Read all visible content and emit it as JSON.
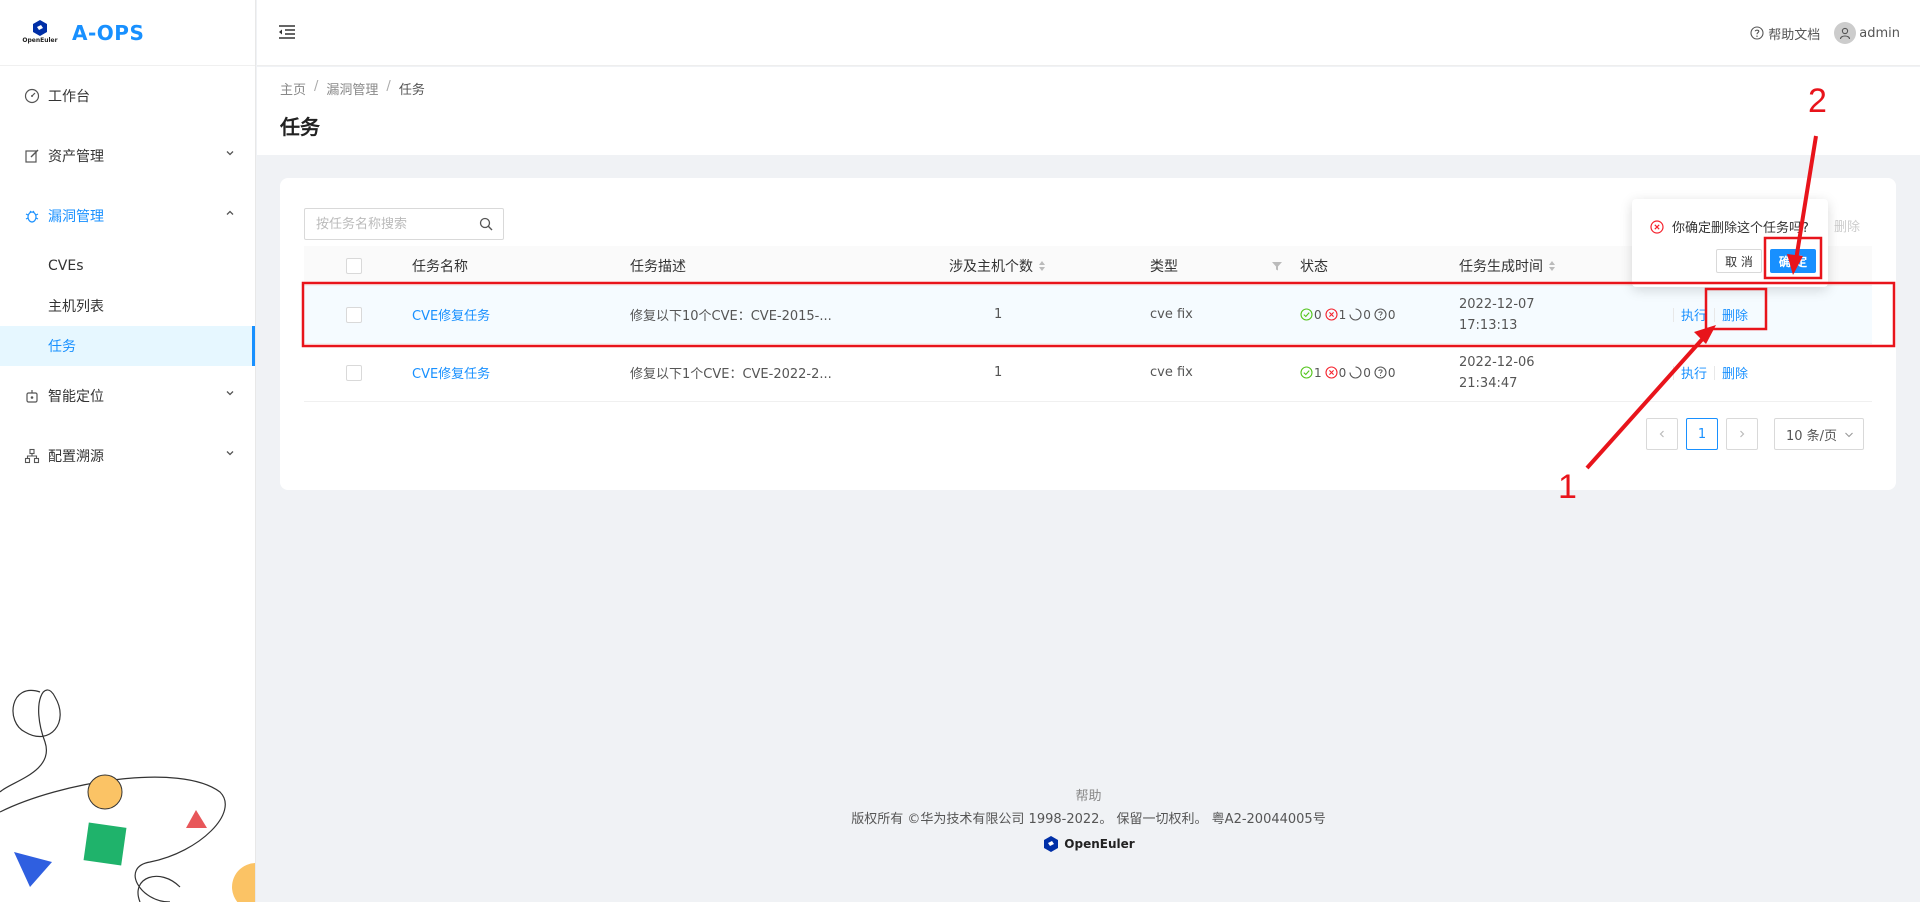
{
  "app": {
    "name": "A-OPS",
    "logo_caption": "OpenEuler"
  },
  "header": {
    "help_label": "帮助文档",
    "user_name": "admin"
  },
  "sidebar": {
    "items": [
      {
        "label": "工作台",
        "icon": "dashboard-icon"
      },
      {
        "label": "资产管理",
        "icon": "edit-icon"
      },
      {
        "label": "漏洞管理",
        "icon": "bug-icon",
        "open": true,
        "children": [
          {
            "label": "CVEs"
          },
          {
            "label": "主机列表"
          },
          {
            "label": "任务",
            "active": true
          }
        ]
      },
      {
        "label": "智能定位",
        "icon": "robot-icon"
      },
      {
        "label": "配置溯源",
        "icon": "cluster-icon"
      }
    ]
  },
  "breadcrumb": {
    "items": [
      "主页",
      "漏洞管理",
      "任务"
    ],
    "separator": "/"
  },
  "page": {
    "title": "任务"
  },
  "search": {
    "placeholder": "按任务名称搜索",
    "value": ""
  },
  "toolbar": {
    "batch_delete": "删除"
  },
  "table": {
    "columns": [
      "任务名称",
      "任务描述",
      "涉及主机个数",
      "类型",
      "状态",
      "任务生成时间"
    ],
    "rows": [
      {
        "name": "CVE修复任务",
        "desc": "修复以下10个CVE：CVE-2015-...",
        "hosts": "1",
        "type": "cve fix",
        "status": {
          "succeed": "0",
          "fail": "1",
          "running": "0",
          "unknown": "0"
        },
        "date": "2022-12-07",
        "time": "17:13:13",
        "action_run": "执行",
        "action_delete": "删除"
      },
      {
        "name": "CVE修复任务",
        "desc": "修复以下1个CVE：CVE-2022-2...",
        "hosts": "1",
        "type": "cve fix",
        "status": {
          "succeed": "1",
          "fail": "0",
          "running": "0",
          "unknown": "0"
        },
        "date": "2022-12-06",
        "time": "21:34:47",
        "action_run": "执行",
        "action_delete": "删除"
      }
    ]
  },
  "pagination": {
    "current": "1",
    "page_size": "10 条/页"
  },
  "popconfirm": {
    "message": "你确定删除这个任务吗?",
    "cancel": "取 消",
    "ok": "确 定"
  },
  "annotations": {
    "step1": "1",
    "step2": "2",
    "color": "#e8141b"
  },
  "footer": {
    "help": "帮助",
    "copyright": "版权所有 ©华为技术有限公司 1998-2022。 保留一切权利。 粤A2-20044005号",
    "brand": "OpenEuler"
  },
  "colors": {
    "primary": "#1890ff",
    "success": "#52c41a",
    "error": "#f5222d"
  }
}
